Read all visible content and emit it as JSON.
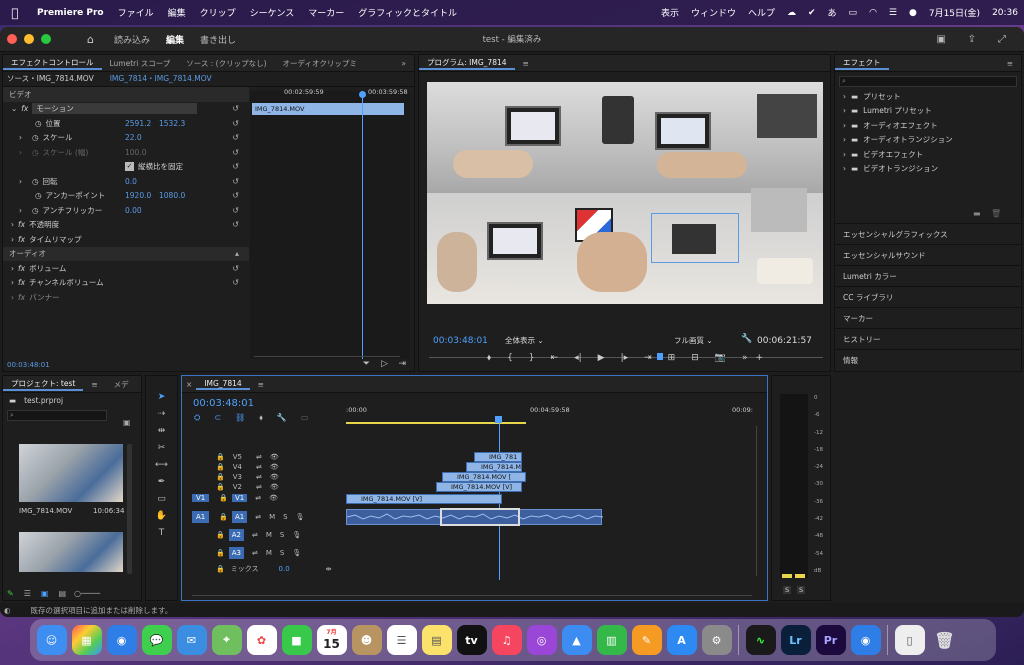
{
  "menubar": {
    "app": "Premiere Pro",
    "items": [
      "ファイル",
      "編集",
      "クリップ",
      "シーケンス",
      "マーカー",
      "グラフィックとタイトル",
      "表示",
      "ウィンドウ",
      "ヘルプ"
    ],
    "date": "7月15日(金)",
    "time": "20:36"
  },
  "titlebar": {
    "workspaces": [
      "読み込み",
      "編集",
      "書き出し"
    ],
    "title": "test - 編集済み"
  },
  "effect_controls": {
    "tabs": [
      "エフェクトコントロール",
      "Lumetri スコープ",
      "ソース : (クリップなし)",
      "オーディオクリップミ"
    ],
    "source": "ソース・IMG_7814.MOV",
    "sequence": "IMG_7814・IMG_7814.MOV",
    "tc_left": "00:02:59:59",
    "tc_right": "00:03:59:58",
    "clip": "IMG_7814.MOV",
    "video_header": "ビデオ",
    "motion": "モーション",
    "position_label": "位置",
    "position_x": "2591.2",
    "position_y": "1532.3",
    "scale_label": "スケール",
    "scale": "22.0",
    "scale_w_label": "スケール (幅)",
    "scale_w": "100.0",
    "uniform_label": "縦横比を固定",
    "rotation_label": "回転",
    "rotation": "0.0",
    "anchor_label": "アンカーポイント",
    "anchor_x": "1920.0",
    "anchor_y": "1080.0",
    "flicker_label": "アンチフリッカー",
    "flicker": "0.00",
    "opacity": "不透明度",
    "timeremap": "タイムリマップ",
    "audio_header": "オーディオ",
    "volume": "ボリューム",
    "channel_volume": "チャンネルボリューム",
    "panner": "パンナー",
    "timecode": "00:03:48:01"
  },
  "program": {
    "tab": "プログラム: IMG_7814",
    "timecode": "00:03:48:01",
    "fit": "全体表示",
    "quality": "フル画質",
    "duration": "00:06:21:57"
  },
  "effects": {
    "tab": "エフェクト",
    "items": [
      "プリセット",
      "Lumetri プリセット",
      "オーディオエフェクト",
      "オーディオトランジション",
      "ビデオエフェクト",
      "ビデオトランジション"
    ],
    "panels": [
      "エッセンシャルグラフィックス",
      "エッセンシャルサウンド",
      "Lumetri カラー",
      "CC ライブラリ",
      "マーカー",
      "ヒストリー",
      "情報"
    ]
  },
  "project": {
    "tabs": [
      "プロジェクト: test",
      "メデ"
    ],
    "file": "test.prproj",
    "item1": "IMG_7814.MOV",
    "item1_dur": "10:06:34"
  },
  "timeline": {
    "tab": "IMG_7814",
    "timecode": "00:03:48:01",
    "ruler": [
      ":00:00",
      "00:04:59:58",
      "00:09:"
    ],
    "tracks_v": [
      "V5",
      "V4",
      "V3",
      "V2",
      "V1"
    ],
    "tracks_a": [
      "A1",
      "A2",
      "A3"
    ],
    "mix": "ミックス",
    "mix_val": "0.0",
    "clips": {
      "v5": "IMG_781",
      "v4": "IMG_7814.M",
      "v3": "IMG_7814.MOV [",
      "v2": "IMG_7814.MOV [V]",
      "v1": "IMG_7814.MOV [V]"
    }
  },
  "meter": {
    "scale": [
      "0",
      "-6",
      "-12",
      "-18",
      "-24",
      "-30",
      "-36",
      "-42",
      "-48",
      "-54",
      "dB"
    ]
  },
  "status": "既存の選択項目に追加または削除します。",
  "dock": {
    "calendar_month": "7月",
    "calendar_day": "15"
  },
  "colors": {
    "accent": "#2d8ceb",
    "timecode": "#4ea1ff"
  }
}
